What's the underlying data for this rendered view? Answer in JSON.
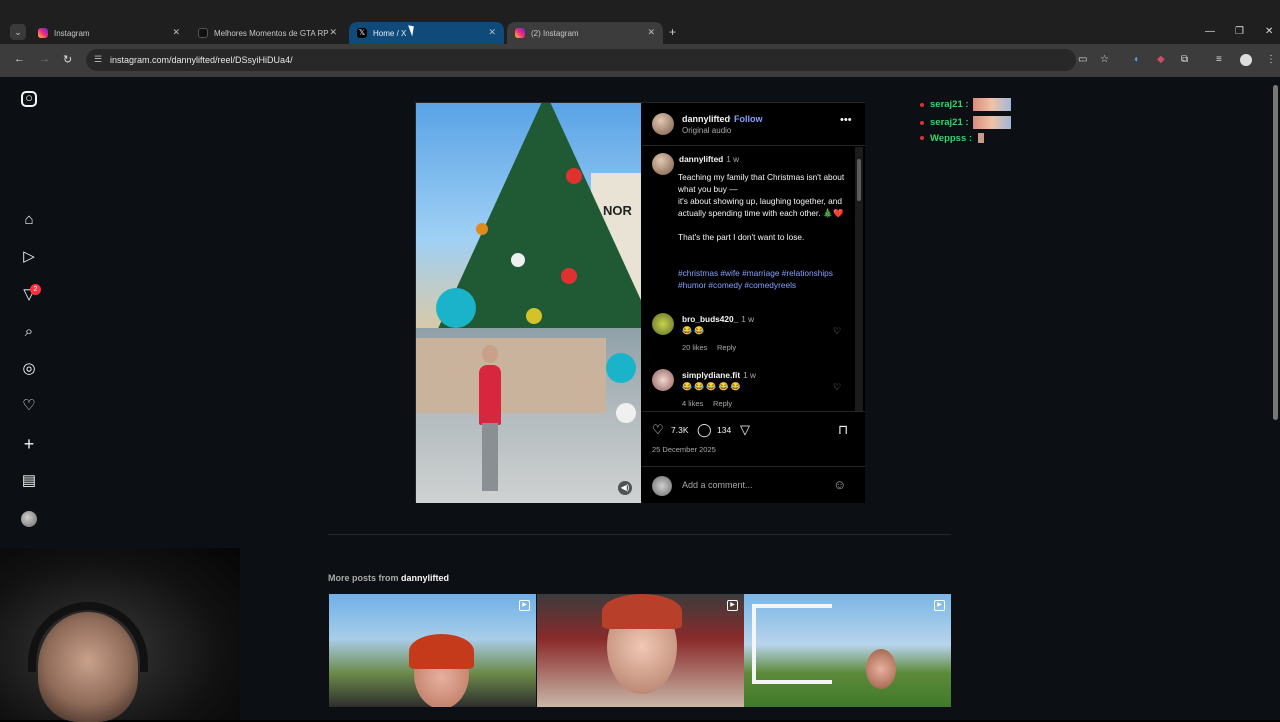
{
  "browser": {
    "tabs": [
      {
        "title": "Instagram",
        "favicon": "instagram-icon"
      },
      {
        "title": "Melhores Momentos de GTA RP",
        "favicon": "tiktok-icon"
      },
      {
        "title": "Home / X",
        "favicon": "x-icon"
      },
      {
        "title": "(2) Instagram",
        "favicon": "instagram-icon"
      }
    ],
    "url": "instagram.com/dannylifted/reel/DSsyiHiDUa4/"
  },
  "sidebar": {
    "notification_count": "2"
  },
  "post": {
    "username": "dannylifted",
    "follow_label": "Follow",
    "separator": "•",
    "audio": "Original audio",
    "caption_user": "dannylifted",
    "caption_time": "1 w",
    "caption": "Teaching my family that Christmas isn't about what you buy —\nit's about showing up, laughing together, and actually spending time with each other. 🎄❤️\n\nThat's the part I don't want to lose.",
    "hashtags": "#christmas #wife #marriage #relationships #humor #comedy #comedyreels",
    "comments": [
      {
        "user": "bro_buds420_",
        "time": "1 w",
        "text": "😂 😂",
        "likes": "20 likes",
        "reply": "Reply"
      },
      {
        "user": "simplydiane.fit",
        "time": "1 w",
        "text": "😂 😂 😂 😂 😂",
        "likes": "4 likes",
        "reply": "Reply"
      }
    ],
    "like_count": "7.3K",
    "comment_count": "134",
    "date": "25 December 2025",
    "add_comment_placeholder": "Add a comment..."
  },
  "chat": [
    {
      "user": "seraj21 :",
      "color": "#3bd16f"
    },
    {
      "user": "seraj21 :",
      "color": "#3bd16f"
    },
    {
      "user": "Weppss :",
      "color": "#3bd16f"
    }
  ],
  "more_posts": {
    "label": "More posts from",
    "user": "dannylifted"
  }
}
